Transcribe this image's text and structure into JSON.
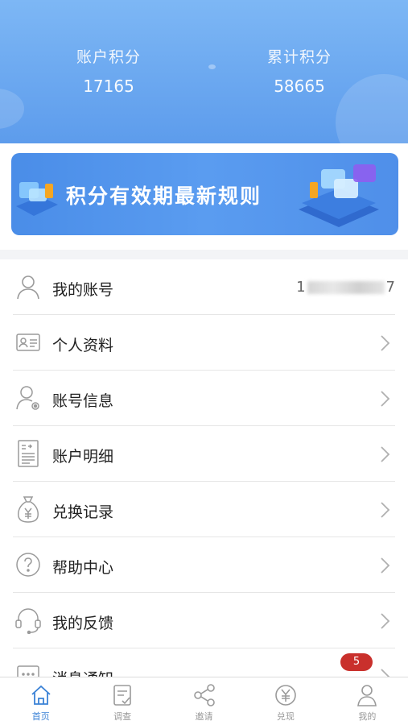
{
  "stats": {
    "account_points_label": "账户积分",
    "account_points_value": "17165",
    "total_points_label": "累计积分",
    "total_points_value": "58665"
  },
  "banner": {
    "title": "积分有效期最新规则"
  },
  "menu": {
    "items": [
      {
        "label": "我的账号",
        "icon": "user-icon",
        "value_prefix": "1",
        "value_suffix": "7"
      },
      {
        "label": "个人资料",
        "icon": "id-card-icon"
      },
      {
        "label": "账号信息",
        "icon": "user-settings-icon"
      },
      {
        "label": "账户明细",
        "icon": "document-icon"
      },
      {
        "label": "兑换记录",
        "icon": "money-bag-icon"
      },
      {
        "label": "帮助中心",
        "icon": "question-icon"
      },
      {
        "label": "我的反馈",
        "icon": "headset-icon"
      },
      {
        "label": "消息通知",
        "icon": "message-icon",
        "badge": "5"
      }
    ]
  },
  "tabbar": {
    "items": [
      {
        "label": "首页",
        "icon": "home-icon",
        "active": true
      },
      {
        "label": "调查",
        "icon": "survey-icon"
      },
      {
        "label": "邀请",
        "icon": "share-icon"
      },
      {
        "label": "兑现",
        "icon": "yuan-icon"
      },
      {
        "label": "我的",
        "icon": "profile-icon"
      }
    ]
  },
  "colors": {
    "accent": "#3b82d6",
    "header": "#6aa8f2",
    "badge": "#c9302c"
  }
}
